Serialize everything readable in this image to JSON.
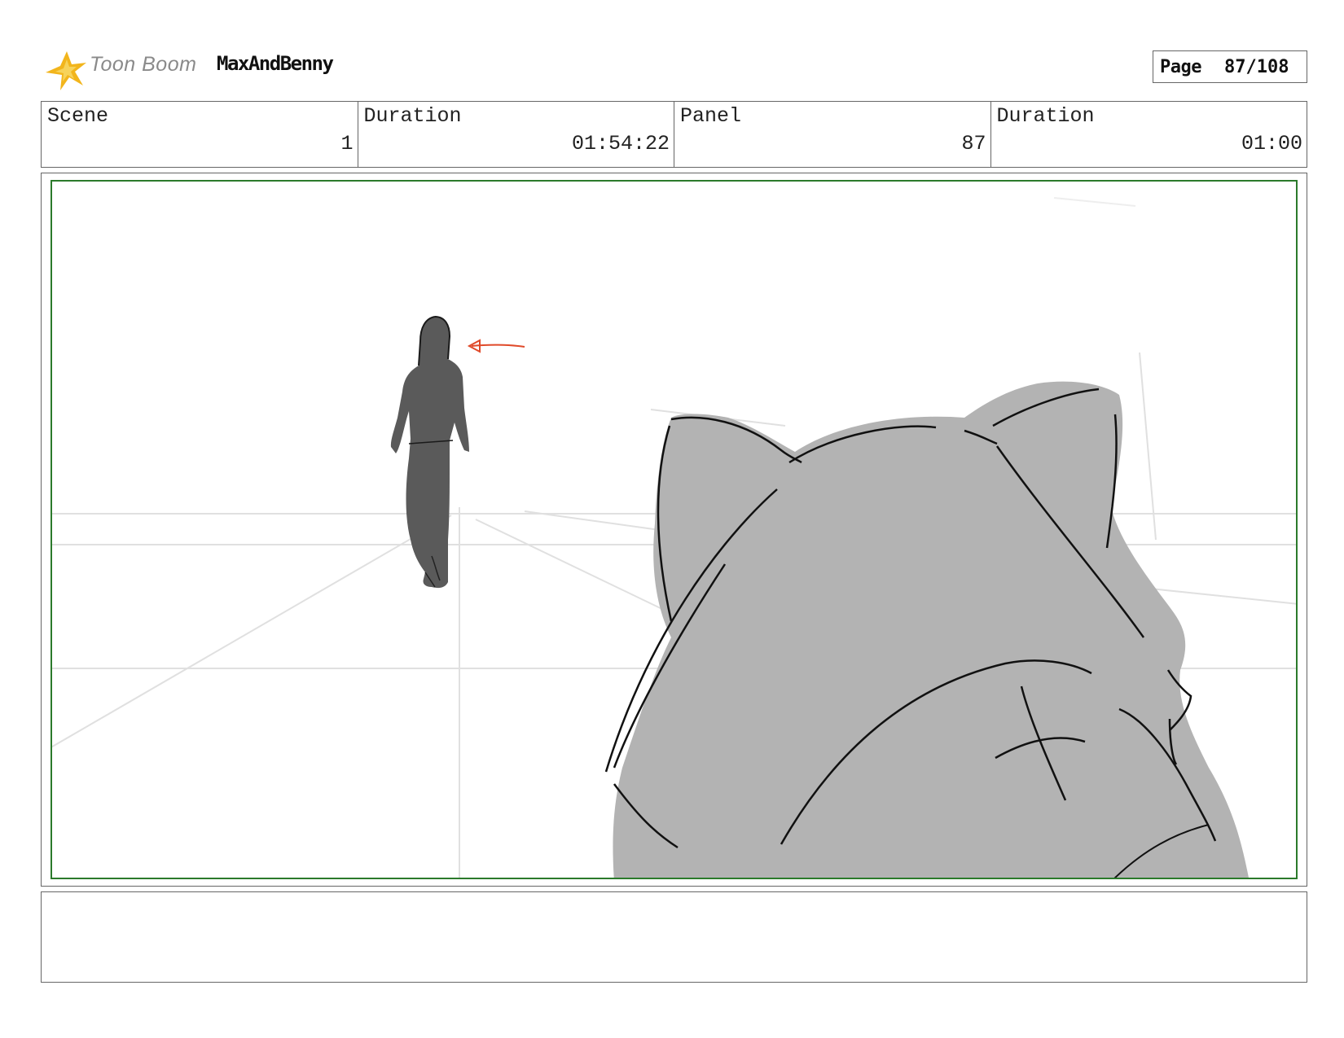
{
  "header": {
    "brand": "Toon Boom",
    "project": "MaxAndBenny",
    "page_label": "Page",
    "page_value": "87/108"
  },
  "info": {
    "scene_label": "Scene",
    "scene_value": "1",
    "duration_label": "Duration",
    "duration_value": "01:54:22",
    "panel_label": "Panel",
    "panel_value": "87",
    "panel_duration_label": "Duration",
    "panel_duration_value": "01:00"
  },
  "panel": {
    "frame_color": "#2b7a2b",
    "arrow_color": "#e04a2a",
    "figure_color": "#5a5a5a",
    "creature_color": "#b3b3b3"
  },
  "notes": {
    "text": ""
  },
  "icons": {
    "logo": "toon-boom-star-icon"
  }
}
